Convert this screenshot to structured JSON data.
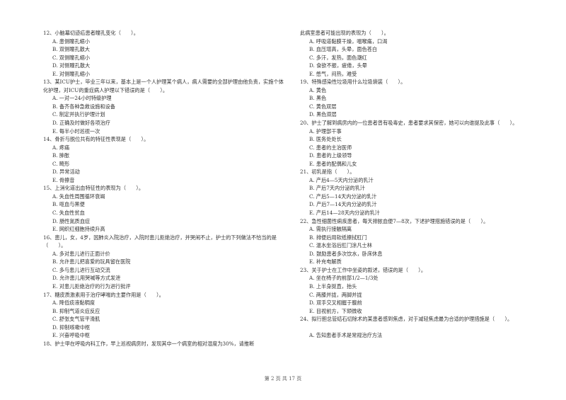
{
  "left_column": [
    {
      "stem": "12、小脑幕切迹疝患者瞳孔变化（　　）。",
      "options": [
        "A. 患侧瞳孔缩小",
        "B. 双侧瞳孔散大",
        "C. 双侧瞳孔缩小",
        "D. 对侧瞳孔散大",
        "E. 对侧瞳孔缩小"
      ]
    },
    {
      "stem": "13、某ICU护士，毕业三年以来，基本上是一个人护理某个病人，病人需要的全部护理由他负责，实施个体化护理，对ICU的重症病人护理以下错误的是（　　）。",
      "options": [
        "A. 一对一24小时特级护理",
        "B. 备齐各种急救设施和设备",
        "C. 制定并执行护理计划",
        "D. 正确及时做好各项治疗",
        "E. 每半小时巡视一次"
      ]
    },
    {
      "stem": "14、骨折与脱位共有的特征性表现是（　　）。",
      "options": [
        "A. 疼痛",
        "B. 肿胀",
        "C. 畸形",
        "D. 异常活动",
        "E. 骨擦音"
      ]
    },
    {
      "stem": "15、上消化道出血特征性的表现为（　　）。",
      "options": [
        "A. 失血性周围循环衰竭",
        "B. 呕血与黑便",
        "C. 失血性贫血",
        "D. 肠性氮质血症",
        "E. 网织红细胞持续升高"
      ]
    },
    {
      "stem": "16、患儿，女，4岁，因肺炎入院治疗，入院时患儿拒绝治疗，并哭闹不止，护士的下列做法不恰当的是（　　）。",
      "options": [
        "A. 多对患儿进行正面计价",
        "B. 允许患儿把喜爱的玩具留在医院",
        "C. 多与患儿进行互动交流",
        "D. 允许患儿用哭喊等方式发泄",
        "E. 对患儿拒绝治疗的行为进行批评"
      ]
    },
    {
      "stem": "17、糖皮质激素用于治疗哮喘的主要作用是（　　）。",
      "options": [
        "A. 降低痰液黏稠度",
        "B. 抑制气道炎症反应",
        "C. 舒张支气管平滑肌",
        "D. 抑制咳嗽中枢",
        "E. 兴奋呼吸中枢"
      ]
    },
    {
      "stem": "18、护士甲在呼吸内科工作，早上巡视病房时，发现其中一个病室的相对湿度为30%，请推断",
      "options": []
    }
  ],
  "right_column": [
    {
      "stem": "此病室患者可能出现的表现为（　　）。",
      "options": [
        "A. 呼吸道黏膜干燥，咽喉痛，口渴",
        "B. 血压增高，头晕，面色苍白",
        "C. 多汗，发热，面色潮红",
        "D. 食欲不振，疲倦，头晕",
        "E. 憋气，闷热，难受"
      ]
    },
    {
      "stem": "19、特殊感染性垃圾用什么垃圾袋装（　　）。",
      "options": [
        "A. 黄色",
        "B. 黑色",
        "C. 黄色双层",
        "D. 黑色双层"
      ]
    },
    {
      "stem": "20、护士了解到病房内的一位患者曾有吸毒史，患者要求其保密，她可以向谁提及此事（　　）。",
      "options": [
        "A. 护理部干事",
        "B. 医务处处长",
        "C. 患者的主治医师",
        "D. 患者的上级领导",
        "E. 患者的配偶和儿女"
      ]
    },
    {
      "stem": "21、初乳是指（　　）。",
      "options": [
        "A. 产后4—5天内分泌的乳汁",
        "B. 产后7天内分泌的乳汁",
        "C. 产后5—14天内分泌的乳汁",
        "D. 产后7—14天内分泌的乳汁",
        "E. 产后14—28天内分泌的乳汁"
      ]
    },
    {
      "stem": "22、急性细菌性痢疾患者，每天排脓血便7—8次，下述护理措施错误的是（　　）。",
      "options": [
        "A. 需执行接触隔离",
        "B. 排便后用软纸擦拭肛门",
        "C. 温水坐浴后肛门涂凡士林",
        "D. 鼓励患者多次饮水，卧床休息",
        "E. 补充电解质"
      ]
    },
    {
      "stem": "23、关于护士在工作中坐姿的叙述，错误的是（　　）。",
      "options": [
        "A. 坐在椅子的前部1/2—1/3处",
        "B. 上半身挺直，抬头",
        "C. 两膝并拢，两脚并拢",
        "D. 双手交叉相握于腹前",
        "E. 目视前方，下颌微收"
      ]
    },
    {
      "stem": "24、拟行胆总管结石切除术的某患者感到焦虑，对于减轻焦虑最为合适的护理措施是（　　）。",
      "options": [
        "",
        "A. 告知患者手术是常规治疗方法"
      ]
    }
  ],
  "footer": {
    "page_label": "第 2 页 共 17 页"
  }
}
